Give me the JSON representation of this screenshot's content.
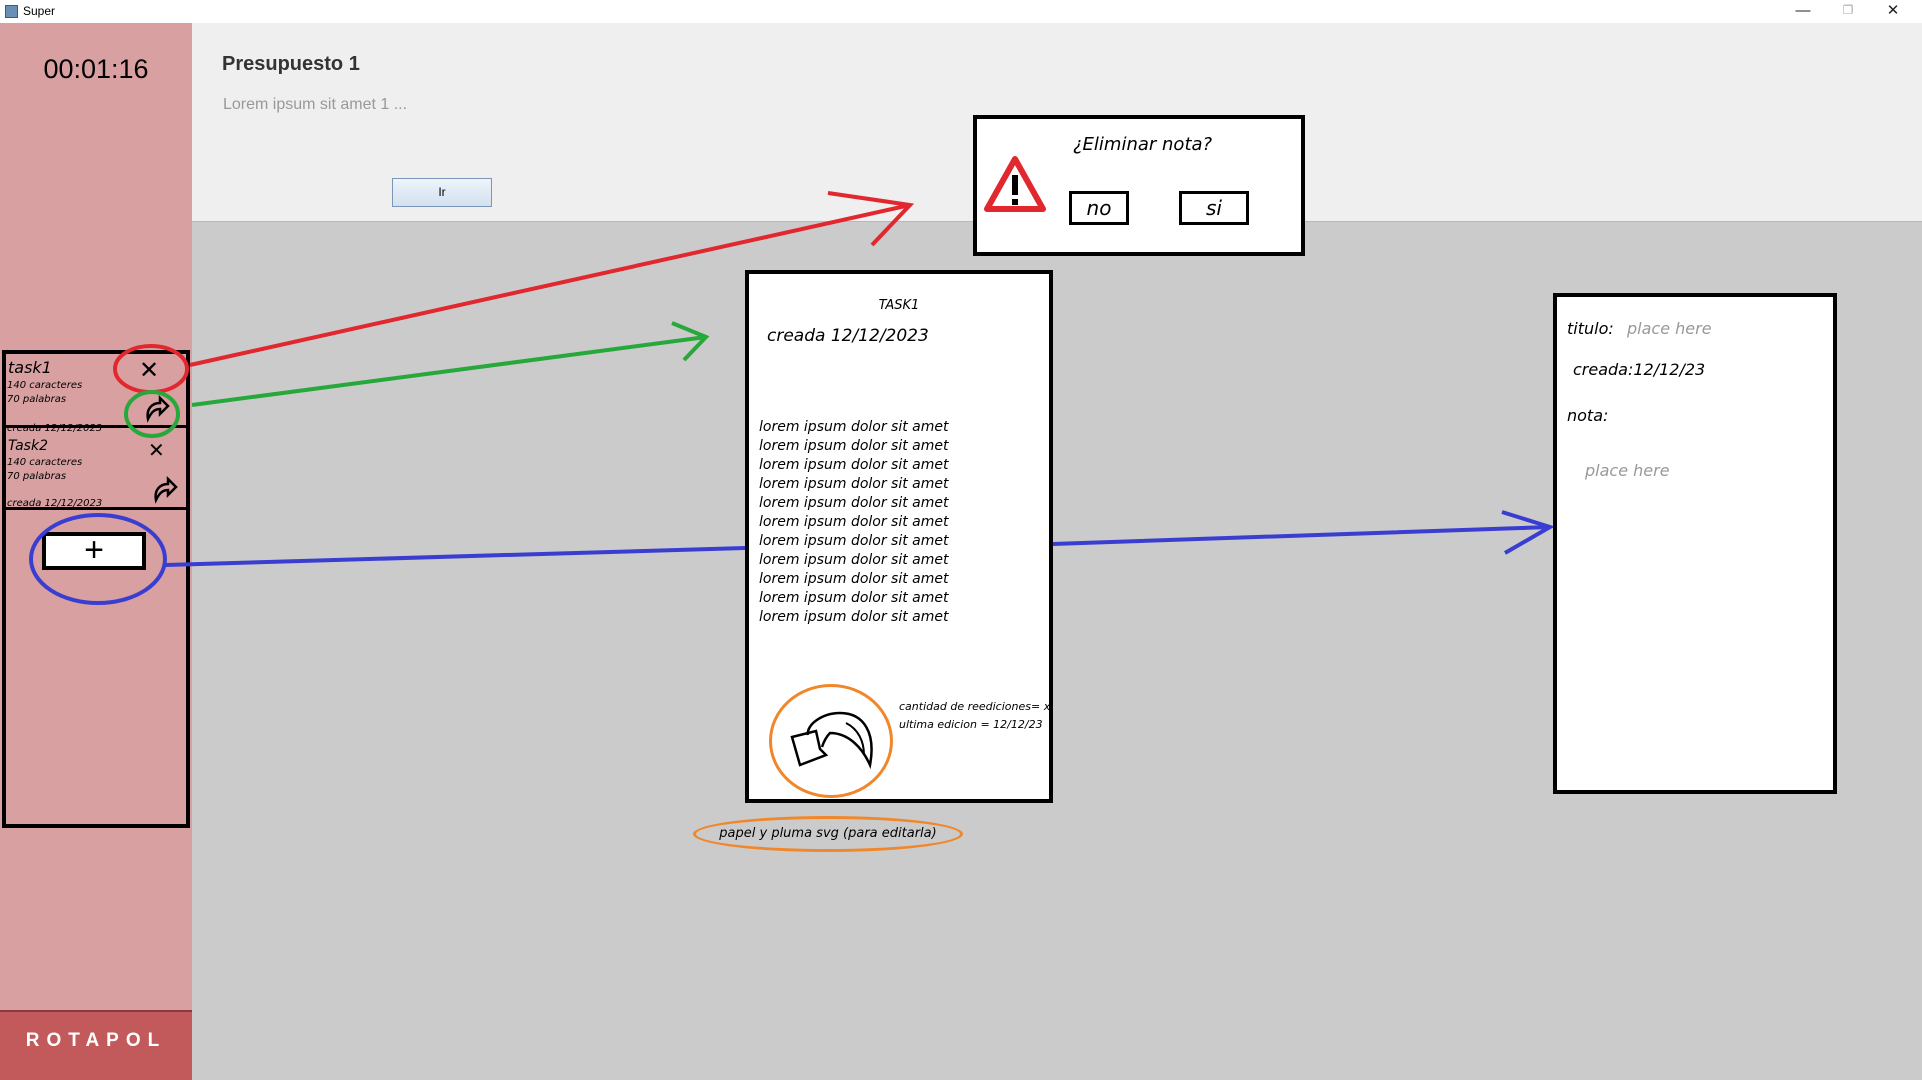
{
  "window": {
    "title": "Super",
    "minimize": "—",
    "restore": "❐",
    "close": "✕"
  },
  "sidebar": {
    "timer": "00:01:16",
    "tasks": [
      {
        "name": "task1",
        "chars": "140 caracteres",
        "words": "70 palabras",
        "created": "creada 12/12/2023",
        "close": "✕"
      },
      {
        "name": "Task2",
        "chars": "140 caracteres",
        "words": "70 palabras",
        "created": "creada 12/12/2023",
        "close": "✕"
      }
    ],
    "add_label": "+",
    "brand": "ROTAPOL"
  },
  "header": {
    "title": "Presupuesto 1",
    "description": "Lorem ipsum sit amet 1 ...",
    "button": "Ir"
  },
  "dialog": {
    "question": "¿Eliminar nota?",
    "no_label": "no",
    "yes_label": "si",
    "icon": "warning-icon"
  },
  "note": {
    "title": "TASK1",
    "created": "creada 12/12/2023",
    "lines": [
      "lorem ipsum dolor sit amet",
      "lorem ipsum dolor sit amet",
      "lorem ipsum dolor sit amet",
      "lorem ipsum dolor sit amet",
      "lorem ipsum dolor sit amet",
      "lorem ipsum dolor sit amet",
      "lorem ipsum dolor sit amet",
      "lorem ipsum dolor sit amet",
      "lorem ipsum dolor sit amet",
      "lorem ipsum dolor sit amet",
      "lorem ipsum dolor sit amet"
    ],
    "edits": "cantidad de reediciones= x",
    "last_edit": "ultima edicion = 12/12/23",
    "caption": "papel y pluma svg (para editarla)",
    "edit_icon": "paper-and-pen-icon"
  },
  "form": {
    "title_label": "titulo:",
    "title_placeholder": "place here",
    "created": "creada:12/12/23",
    "note_label": "nota:",
    "note_placeholder": "place here"
  },
  "colors": {
    "sidebar": "#d9a0a2",
    "brand": "#c2595b",
    "main": "#cbcbcb",
    "header": "#efefef",
    "red": "#e0282e",
    "green": "#27a83a",
    "blue": "#3a3ed0",
    "orange": "#f0872a"
  }
}
